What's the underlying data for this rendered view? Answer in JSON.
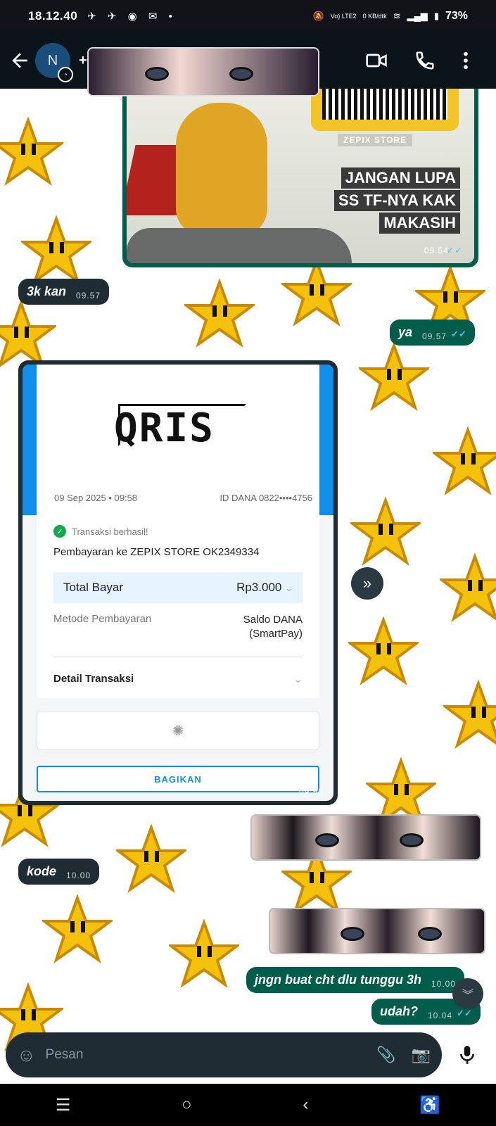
{
  "status_bar": {
    "time": "18.12.40",
    "notif_icons": "✈ ✈ ◉ ✉ •",
    "network": "Vo) LTE2",
    "speed": "0 KB/dtk",
    "battery": "73%"
  },
  "app_bar": {
    "avatar_initial": "N",
    "contact_name": "+6"
  },
  "image_message": {
    "store": "ZEPIX STORE",
    "caption_lines": [
      "JANGAN LUPA",
      "SS TF-NYA KAK",
      "MAKASIH"
    ],
    "time": "09.54"
  },
  "messages": [
    {
      "text": "3k kan",
      "time": "09.57",
      "direction": "in"
    },
    {
      "text": "ya",
      "time": "09.57",
      "direction": "out"
    },
    {
      "text": "kode",
      "time": "10.00",
      "direction": "in"
    },
    {
      "text": "jngn buat cht dlu tunggu 3h",
      "time": "10.00",
      "direction": "out"
    },
    {
      "text": "udah?",
      "time": "10.04",
      "direction": "out"
    }
  ],
  "receipt": {
    "logo": "QRIS",
    "date": "09 Sep 2025 • 09:58",
    "id_label": "ID DANA 0822••••4756",
    "status": "Transaksi berhasil!",
    "payment": "Pembayaran ke ZEPIX STORE OK2349334",
    "total_label": "Total Bayar",
    "total_value": "Rp3.000",
    "method_label": "Metode Pembayaran",
    "method_value_1": "Saldo DANA",
    "method_value_2": "(SmartPay)",
    "detail_label": "Detail Transaksi",
    "share_label": "BAGIKAN",
    "time": "09.58"
  },
  "composer": {
    "placeholder": "Pesan"
  },
  "colors": {
    "incoming": "#1f2c34",
    "outgoing": "#005c4b",
    "dana_blue": "#118ee9",
    "star": "#f4c20d"
  }
}
